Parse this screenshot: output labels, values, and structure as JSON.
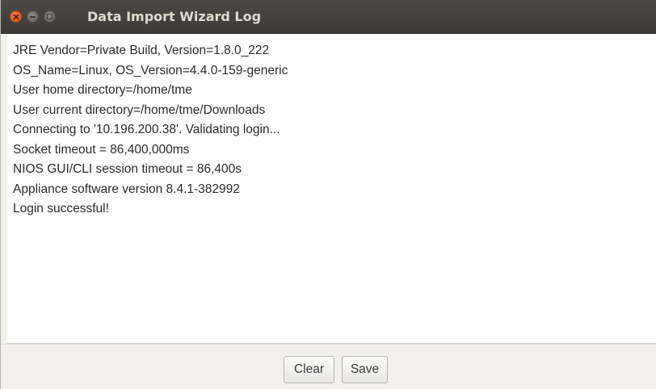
{
  "window": {
    "title": "Data Import Wizard Log"
  },
  "log": {
    "lines": [
      "JRE Vendor=Private Build, Version=1.8.0_222",
      "OS_Name=Linux, OS_Version=4.4.0-159-generic",
      "User home directory=/home/tme",
      "User current directory=/home/tme/Downloads",
      "Connecting to '10.196.200.38'. Validating login...",
      "Socket timeout = 86,400,000ms",
      "NIOS GUI/CLI session timeout = 86,400s",
      "Appliance software version 8.4.1-382992",
      "Login successful!"
    ]
  },
  "buttons": {
    "clear_label": "Clear",
    "save_label": "Save"
  },
  "colors": {
    "titlebar": "#3c3b37",
    "close_button": "#e3531d",
    "log_background": "#ffffff"
  }
}
